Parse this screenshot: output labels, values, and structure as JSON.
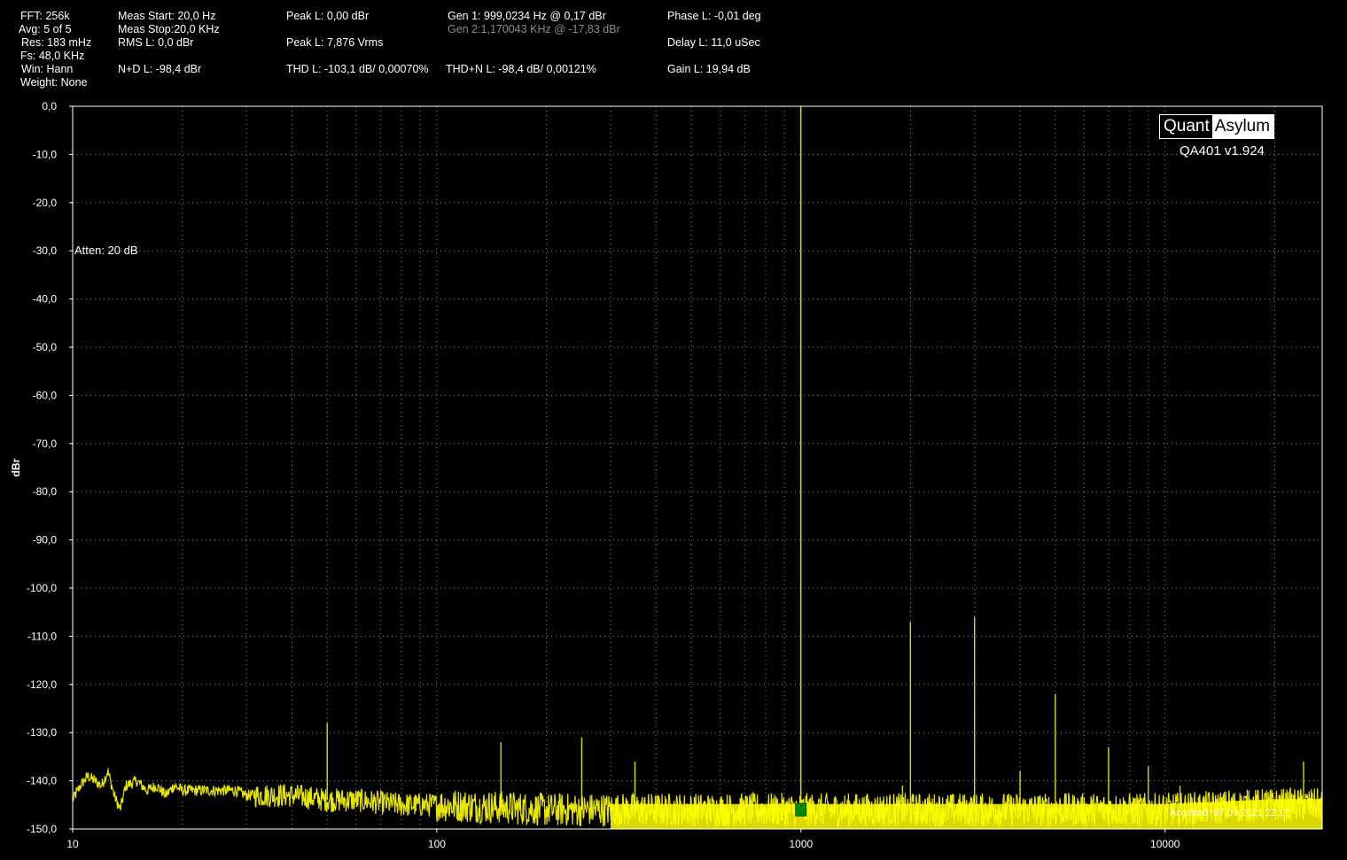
{
  "stats": {
    "fft": "FFT: 256k",
    "avg": "Avg: 5 of 5",
    "res": "Res: 183 mHz",
    "fs": "Fs: 48,0 KHz",
    "win": "Win: Hann",
    "weight": "Weight: None",
    "meas_start": "Meas Start: 20,0 Hz",
    "meas_stop": "Meas Stop:20,0 KHz",
    "rms": "RMS L: 0,0 dBr",
    "nd": "N+D L: -98,4 dBr",
    "peak_dbr": "Peak L: 0,00 dBr",
    "peak_vrms": "Peak L: 7,876 Vrms",
    "thd": "THD L: -103,1 dB/ 0,00070%",
    "gen1": "Gen 1: 999,0234 Hz @ 0,17  dBr",
    "gen2": "Gen 2:1,170043 KHz @ -17,83  dBr",
    "thdn": "THD+N L: -98,4 dB/ 0,00121%",
    "phase": "Phase L: -0,01 deg",
    "delay": "Delay L: 11,0 uSec",
    "gain": "Gain L: 19,94 dB"
  },
  "annotation": "Atten: 20 dB",
  "brand": {
    "name_part1": "Quant",
    "name_part2": "Asylum",
    "version": "QA401 v1.924",
    "acquired": "Acquired: 07.09.2021 22:17"
  },
  "colors": {
    "background": "#000000",
    "trace": "#ffff00",
    "grid": "#8a8a8a",
    "marker": "#008a00",
    "text": "#ffffff"
  },
  "chart_data": {
    "type": "line",
    "title": "",
    "xlabel": "",
    "ylabel": "dBr",
    "x_scale": "log",
    "xlim": [
      10,
      27000
    ],
    "ylim": [
      -150,
      0
    ],
    "x_ticks": [
      "10",
      "100",
      "1000",
      "10000"
    ],
    "y_ticks": [
      "0,0",
      "-10,0",
      "-20,0",
      "-30,0",
      "-40,0",
      "-50,0",
      "-60,0",
      "-70,0",
      "-80,0",
      "-90,0",
      "-100,0",
      "-110,0",
      "-120,0",
      "-130,0",
      "-140,0",
      "-150,0"
    ],
    "grid": true,
    "series": [
      {
        "kind": "noise_floor",
        "points": [
          [
            10,
            -144
          ],
          [
            10.5,
            -141
          ],
          [
            11,
            -139
          ],
          [
            11.5,
            -140
          ],
          [
            12,
            -141
          ],
          [
            12.5,
            -138
          ],
          [
            13,
            -143
          ],
          [
            13.5,
            -146
          ],
          [
            14,
            -141
          ],
          [
            15,
            -140
          ],
          [
            16,
            -142
          ],
          [
            17,
            -141
          ],
          [
            18,
            -143
          ],
          [
            19,
            -141
          ],
          [
            20,
            -142
          ],
          [
            22,
            -142
          ],
          [
            24,
            -142
          ],
          [
            26,
            -142
          ],
          [
            28,
            -142
          ],
          [
            30,
            -143
          ],
          [
            35,
            -143
          ],
          [
            40,
            -143
          ],
          [
            50,
            -144
          ],
          [
            60,
            -144
          ],
          [
            80,
            -145
          ],
          [
            100,
            -145
          ],
          [
            150,
            -145.5
          ],
          [
            200,
            -146
          ],
          [
            300,
            -146
          ],
          [
            500,
            -146
          ],
          [
            1000,
            -146
          ],
          [
            2000,
            -146
          ],
          [
            5000,
            -146
          ],
          [
            10000,
            -146
          ],
          [
            20000,
            -145
          ],
          [
            27000,
            -145
          ]
        ]
      },
      {
        "kind": "spurs",
        "points": [
          [
            999,
            0
          ],
          [
            50,
            -128
          ],
          [
            150,
            -132
          ],
          [
            250,
            -131
          ],
          [
            350,
            -136
          ],
          [
            1900,
            -141
          ],
          [
            1998,
            -107
          ],
          [
            2997,
            -106
          ],
          [
            3996,
            -138
          ],
          [
            4995,
            -122
          ],
          [
            6993,
            -133
          ],
          [
            8991,
            -137
          ],
          [
            10989,
            -141
          ],
          [
            14985,
            -142
          ],
          [
            16983,
            -142
          ],
          [
            18981,
            -142
          ],
          [
            24000,
            -136
          ]
        ]
      }
    ],
    "marker": {
      "x": 999,
      "y": -146
    }
  }
}
